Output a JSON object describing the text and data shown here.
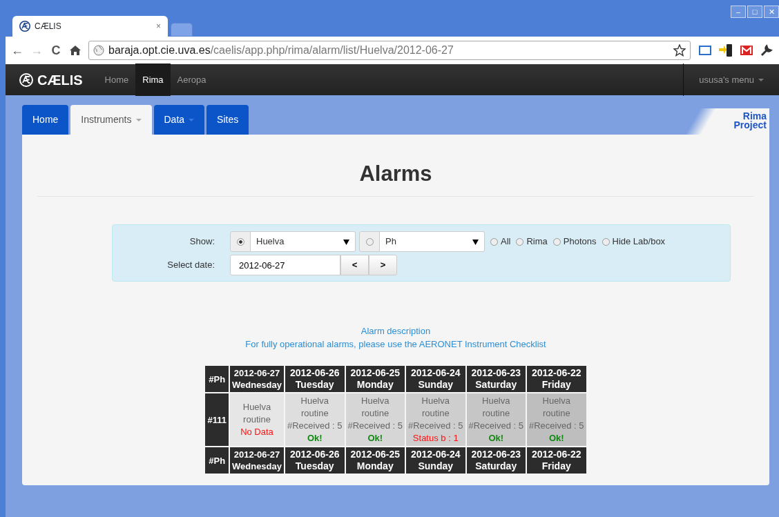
{
  "browser": {
    "tab_title": "CÆLIS",
    "tab_close": "×",
    "url_host": "baraja.opt.cie.uva.es",
    "url_path": "/caelis/app.php/rima/alarm/list/Huelva/2012-06-27",
    "window_buttons": [
      "–",
      "□",
      "✕"
    ],
    "nav_glyphs": [
      "←",
      "→",
      "C"
    ]
  },
  "navbar": {
    "brand": "CÆLIS",
    "items": [
      {
        "label": "Home",
        "selected": false
      },
      {
        "label": "Rima",
        "selected": true
      },
      {
        "label": "Aeropa",
        "selected": false
      }
    ],
    "user_menu": "ususa's menu"
  },
  "tabs": [
    {
      "label": "Home",
      "selected": false,
      "dropdown": false
    },
    {
      "label": "Instruments",
      "selected": true,
      "dropdown": true
    },
    {
      "label": "Data",
      "selected": false,
      "dropdown": true
    },
    {
      "label": "Sites",
      "selected": false,
      "dropdown": false
    }
  ],
  "project_label": [
    "Rima",
    "Project"
  ],
  "title": "Alarms",
  "filters": {
    "show_label": "Show:",
    "date_label": "Select date:",
    "selects": [
      {
        "value": "Huelva",
        "selected": true
      },
      {
        "value": "Ph",
        "selected": false
      }
    ],
    "radios": [
      {
        "label": "All",
        "selected": false
      },
      {
        "label": "Rima",
        "selected": false
      },
      {
        "label": "Photons",
        "selected": false
      },
      {
        "label": "Hide Lab/box",
        "selected": false
      }
    ],
    "date": "2012-06-27",
    "prev": "<",
    "next": ">"
  },
  "alarm_description": "Alarm description",
  "checklist_note": "For fully operational alarms, please use the AERONET Instrument Checklist",
  "table": {
    "corner": "#Ph",
    "columns": [
      {
        "date": "2012-06-27",
        "day": "Wednesday"
      },
      {
        "date": "2012-06-26",
        "day": "Tuesday"
      },
      {
        "date": "2012-06-25",
        "day": "Monday"
      },
      {
        "date": "2012-06-24",
        "day": "Sunday"
      },
      {
        "date": "2012-06-23",
        "day": "Saturday"
      },
      {
        "date": "2012-06-22",
        "day": "Friday"
      }
    ],
    "rows": [
      {
        "id": "#111",
        "cells": [
          {
            "site": "Huelva",
            "routine": "routine",
            "status": "No Data",
            "kind": "error",
            "color": "#e6e6e6"
          },
          {
            "site": "Huelva",
            "routine": "routine",
            "received": "#Received : 5",
            "status": "Ok!",
            "kind": "ok",
            "color": "#dedede"
          },
          {
            "site": "Huelva",
            "routine": "routine",
            "received": "#Received : 5",
            "status": "Ok!",
            "kind": "ok",
            "color": "#d6d6d6"
          },
          {
            "site": "Huelva",
            "routine": "routine",
            "received": "#Received : 5",
            "status": "Status b : 1",
            "kind": "error",
            "color": "#cecece"
          },
          {
            "site": "Huelva",
            "routine": "routine",
            "received": "#Received : 5",
            "status": "Ok!",
            "kind": "ok",
            "color": "#c6c6c6"
          },
          {
            "site": "Huelva",
            "routine": "routine",
            "received": "#Received : 5",
            "status": "Ok!",
            "kind": "ok",
            "color": "#bebebe"
          }
        ]
      }
    ],
    "footer_corner": "#Ph",
    "footer_columns": [
      {
        "date": "2012-06-27",
        "day": "Wednesday"
      },
      {
        "date": "2012-06-26",
        "day": "Tuesday"
      },
      {
        "date": "2012-06-25",
        "day": "Monday"
      },
      {
        "date": "2012-06-24",
        "day": "Sunday"
      },
      {
        "date": "2012-06-23",
        "day": "Saturday"
      },
      {
        "date": "2012-06-22",
        "day": "Friday"
      }
    ]
  }
}
